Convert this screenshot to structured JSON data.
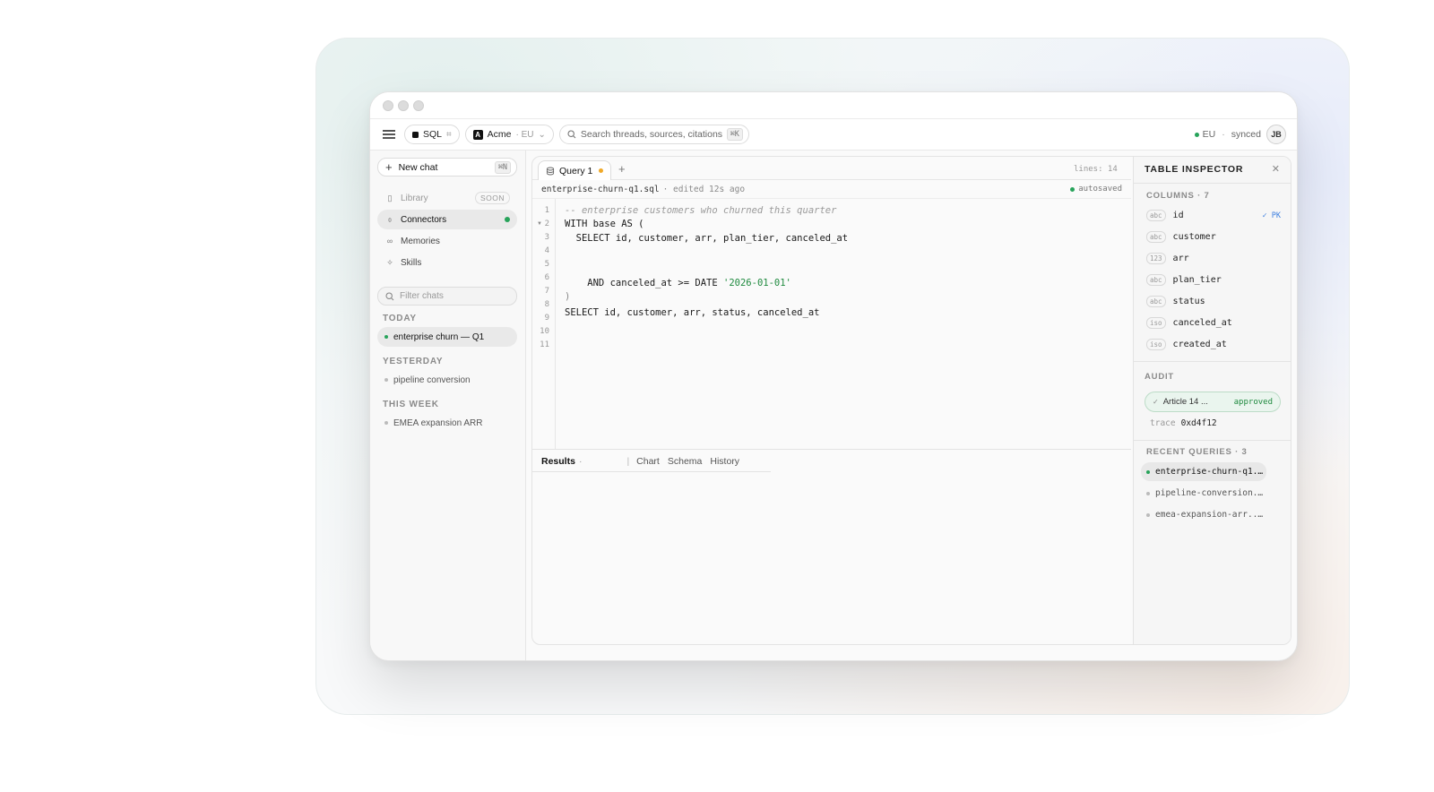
{
  "toolbar": {
    "mode_label": "SQL",
    "workspace_label": "Acme",
    "workspace_region": "· EU",
    "search_placeholder": "Search threads, sources, citations",
    "search_shortcut": "⌘K",
    "region": "EU",
    "separator": "·",
    "sync_status": "synced",
    "user_initials": "JB"
  },
  "sidebar": {
    "new_chat_label": "New chat",
    "new_chat_shortcut": "⌘N",
    "nav": [
      {
        "label": "Library",
        "badge": "SOON",
        "icon": "book-icon"
      },
      {
        "label": "Connectors",
        "icon": "plug-icon",
        "active": true
      },
      {
        "label": "Memories",
        "icon": "memory-icon"
      },
      {
        "label": "Skills",
        "icon": "sparkle-icon"
      }
    ],
    "filter_placeholder": "Filter chats",
    "sections": [
      {
        "title": "TODAY",
        "chats": [
          "enterprise churn — Q1"
        ]
      },
      {
        "title": "YESTERDAY",
        "chats": [
          "pipeline conversion"
        ]
      },
      {
        "title": "THIS WEEK",
        "chats": [
          "EMEA expansion ARR"
        ]
      }
    ]
  },
  "editor": {
    "tab_label": "Query 1",
    "lines_label": "lines: 14",
    "filename": "enterprise-churn-q1.sql",
    "edited": "· edited 12s ago",
    "save_status": "autosaved",
    "line_numbers": [
      "1",
      "2",
      "3",
      "4",
      "5",
      "6",
      "7",
      "8",
      "9",
      "10",
      "11"
    ],
    "code": {
      "l1": "-- enterprise customers who churned this quarter",
      "l2": "WITH base AS (",
      "l3": "  SELECT id, customer, arr, plan_tier, canceled_at",
      "l7_pre": "    AND canceled_at >= DATE ",
      "l7_str": "'2026-01-01'",
      "l8": ")",
      "l9": "SELECT id, customer, arr, status, canceled_at"
    },
    "result_tabs": {
      "results": "Results",
      "results_suffix": "·",
      "divider": "|",
      "chart": "Chart",
      "schema": "Schema",
      "history": "History"
    }
  },
  "inspector": {
    "title": "TABLE INSPECTOR",
    "columns_label": "COLUMNS · 7",
    "columns": [
      {
        "type": "abc",
        "name": "id",
        "pk": "✓ PK"
      },
      {
        "type": "abc",
        "name": "customer"
      },
      {
        "type": "123",
        "name": "arr"
      },
      {
        "type": "abc",
        "name": "plan_tier"
      },
      {
        "type": "abc",
        "name": "status"
      },
      {
        "type": "iso",
        "name": "canceled_at"
      },
      {
        "type": "iso",
        "name": "created_at"
      }
    ],
    "audit_label": "AUDIT",
    "audit_item": "Article 14 ...",
    "audit_status": "approved",
    "trace_key": "trace",
    "trace_value": "0xd4f12",
    "recent_label": "RECENT QUERIES · 3",
    "recent": [
      "enterprise-churn-q1...",
      "pipeline-conversion...",
      "emea-expansion-arr...."
    ]
  },
  "colors": {
    "accent_green": "#27a35a",
    "unsaved_orange": "#f0a928",
    "pk_blue": "#3d7fe0"
  }
}
